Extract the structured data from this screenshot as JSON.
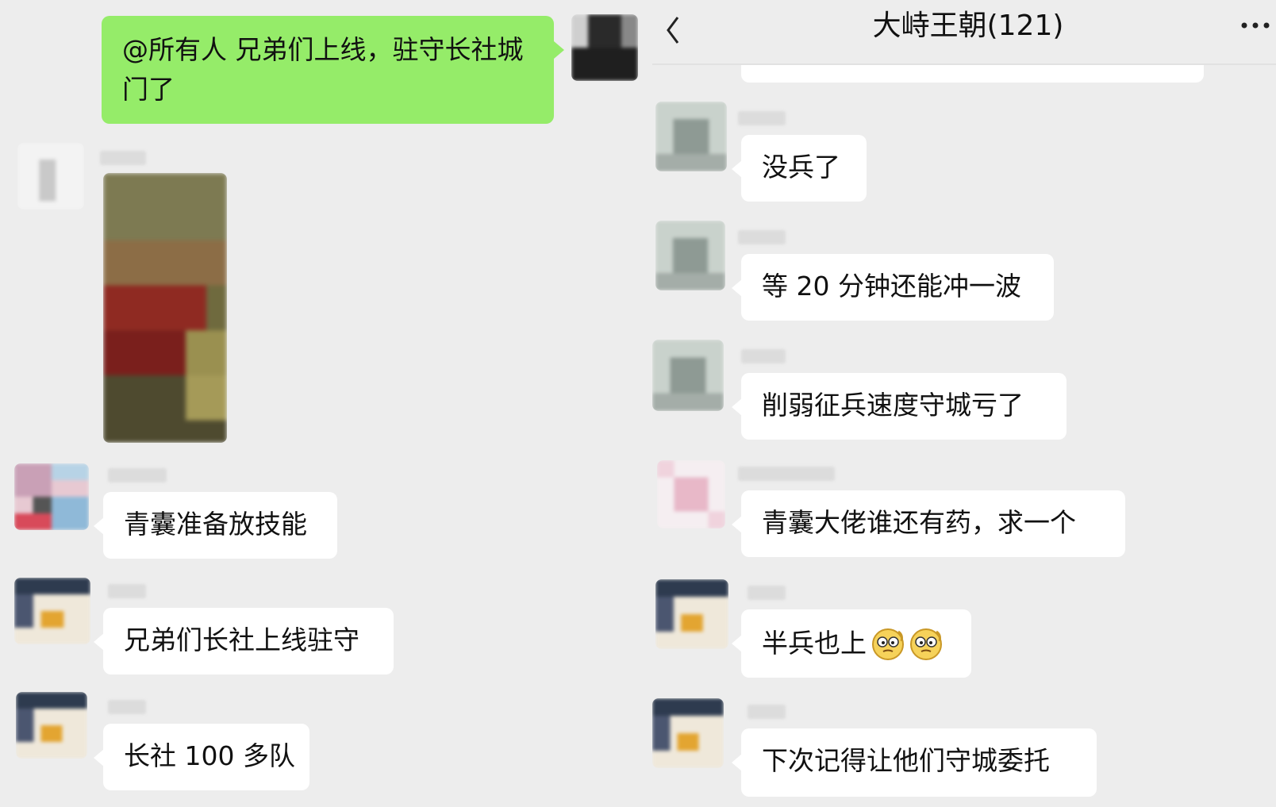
{
  "header": {
    "title": "大峙王朝(121)",
    "back_icon": "chevron-left-icon",
    "more_icon": "more-horizontal-icon"
  },
  "left_panel": {
    "own_message": "@所有人  兄弟们上线，驻守长社城门了",
    "messages": [
      {
        "text": "青囊准备放技能"
      },
      {
        "text": "兄弟们长社上线驻守"
      },
      {
        "text": "长社 100 多队"
      }
    ],
    "image_message": "battle-screenshot"
  },
  "right_panel": {
    "messages": [
      {
        "text": "没兵了"
      },
      {
        "text": "等 20 分钟还能冲一波"
      },
      {
        "text": "削弱征兵速度守城亏了"
      },
      {
        "text": "青囊大佬谁还有药，求一个"
      },
      {
        "text": "半兵也上"
      },
      {
        "text": "下次记得让他们守城委托"
      }
    ]
  },
  "colors": {
    "background": "#ededed",
    "own_bubble": "#95ec69",
    "other_bubble": "#ffffff"
  }
}
